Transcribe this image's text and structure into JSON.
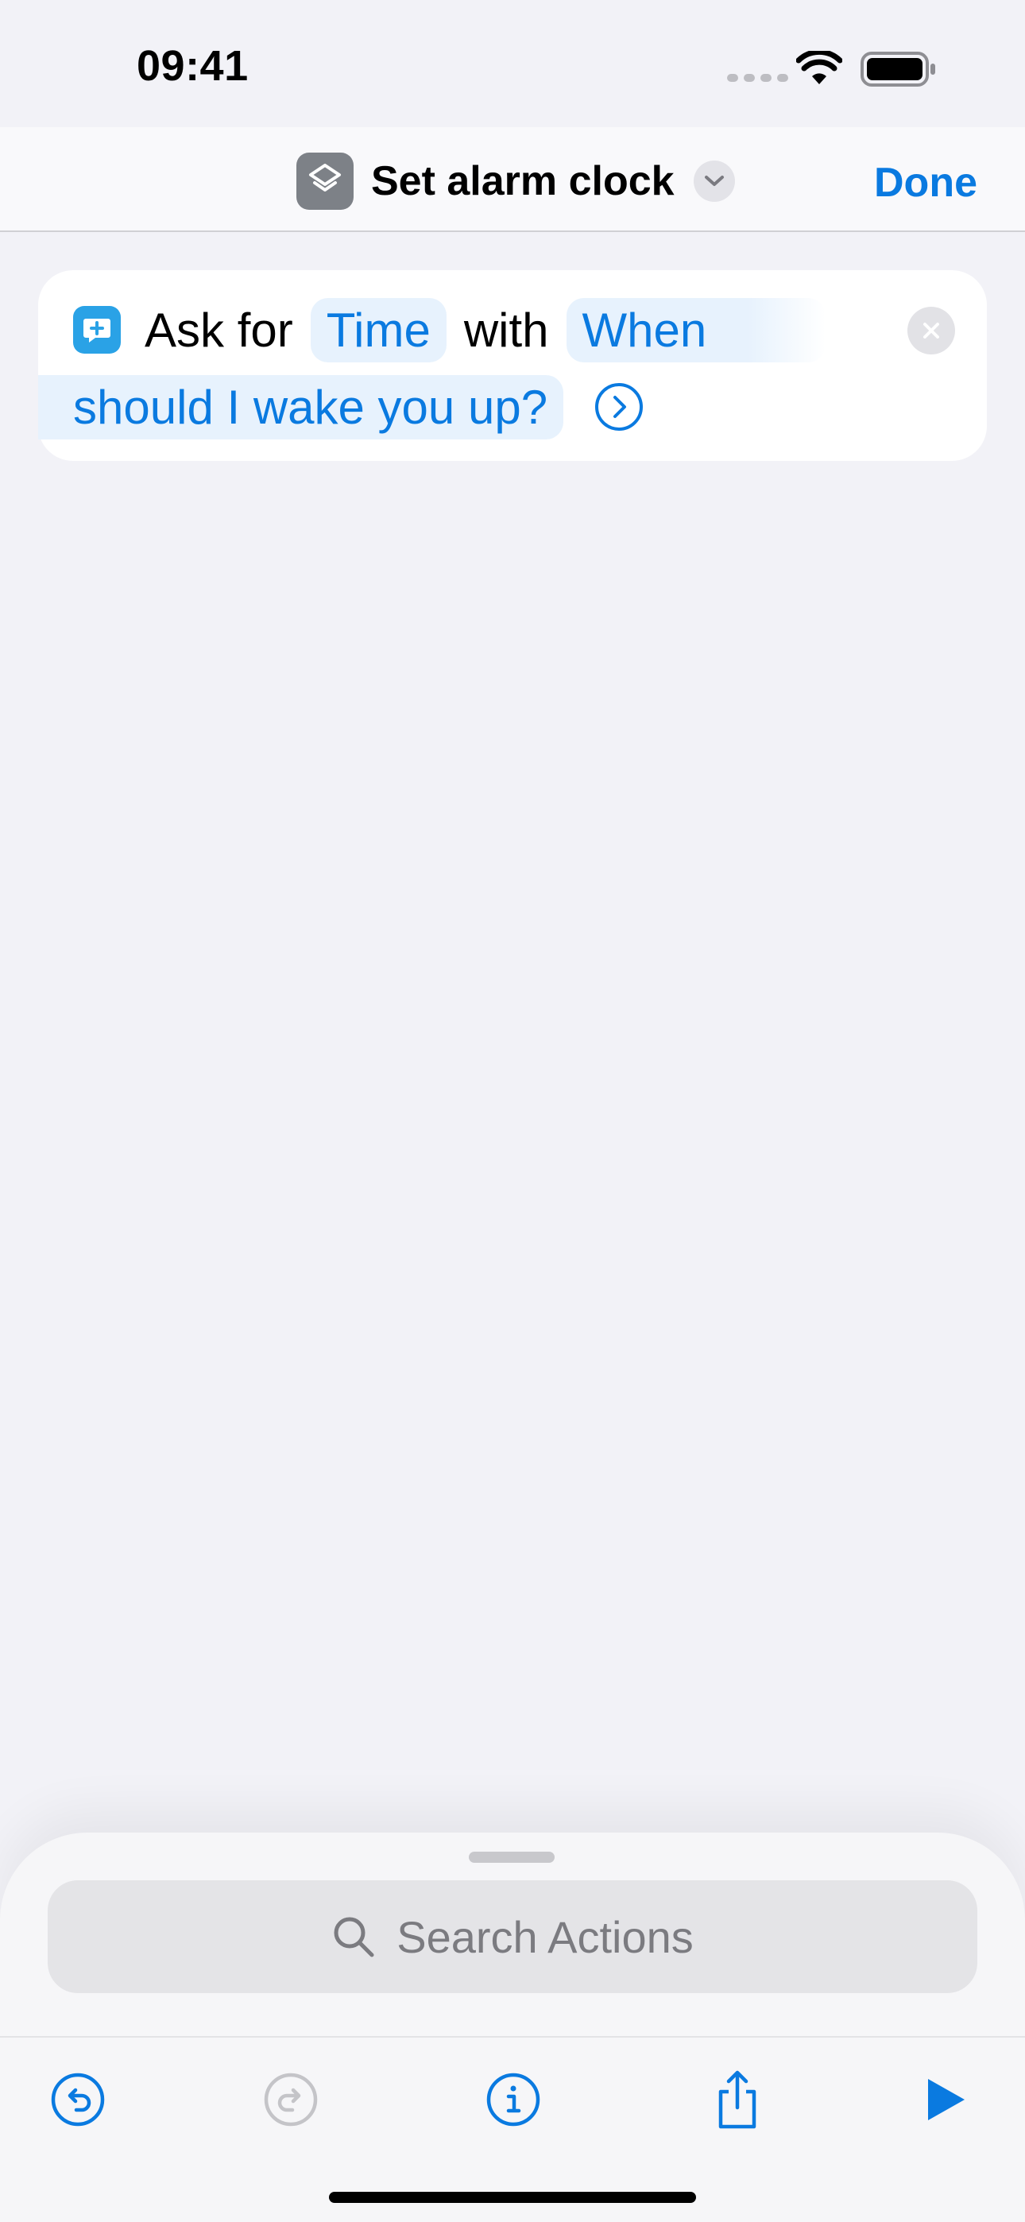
{
  "status_bar": {
    "time": "09:41"
  },
  "nav": {
    "title": "Set alarm clock",
    "done_label": "Done"
  },
  "action": {
    "word_ask_for": "Ask for",
    "token_type": "Time",
    "word_with": "with",
    "prompt_part1": "When",
    "prompt_part2": "should I wake you up?"
  },
  "search": {
    "placeholder": "Search Actions"
  },
  "icons": {
    "app": "shortcuts-layers-icon",
    "title_menu": "chevron-down-icon",
    "action": "ask-for-input-icon",
    "remove": "close-icon",
    "go": "chevron-right-circle-icon",
    "search": "search-icon",
    "undo": "undo-icon",
    "redo": "redo-icon",
    "info": "info-icon",
    "share": "share-icon",
    "run": "play-icon"
  },
  "colors": {
    "accent": "#0A7AE0",
    "background": "#F2F2F7",
    "action_icon": "#2AA2E6",
    "disabled": "#C4C4C8"
  }
}
